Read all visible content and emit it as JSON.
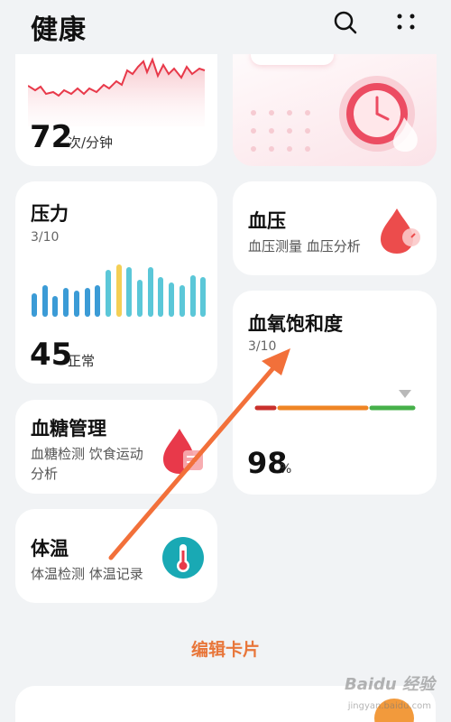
{
  "header": {
    "title": "健康",
    "search_icon": "search-icon",
    "more_icon": "more-dots-icon"
  },
  "heart_card": {
    "value": "72",
    "unit": "次/分钟"
  },
  "stress_card": {
    "title": "压力",
    "count": "3/10",
    "value": "45",
    "status": "正常",
    "bars": [
      0.45,
      0.6,
      0.4,
      0.55,
      0.5,
      0.55,
      0.6,
      0.9,
      1.0,
      0.95,
      0.7,
      0.95,
      0.75,
      0.65,
      0.6,
      0.8,
      0.75
    ]
  },
  "bp_card": {
    "title": "血压",
    "subtitle": "血压测量 血压分析"
  },
  "spo2_card": {
    "title": "血氧饱和度",
    "count": "3/10",
    "value": "98",
    "unit": "%"
  },
  "glucose_card": {
    "title": "血糖管理",
    "subtitle_line1": "血糖检测 饮食运动",
    "subtitle_line2": "分析"
  },
  "temp_card": {
    "title": "体温",
    "subtitle": "体温检测 体温记录"
  },
  "footer": {
    "edit_label": "编辑卡片"
  },
  "watermark": {
    "brand": "Baidu 经验",
    "url": "jingyan.baidu.com"
  },
  "colors": {
    "accent": "#e8763a",
    "stress_blue": "#3b9bd6",
    "stress_yellow": "#f4cf55",
    "stress_cyan": "#5bc7d8",
    "heart_red": "#e8394a"
  }
}
